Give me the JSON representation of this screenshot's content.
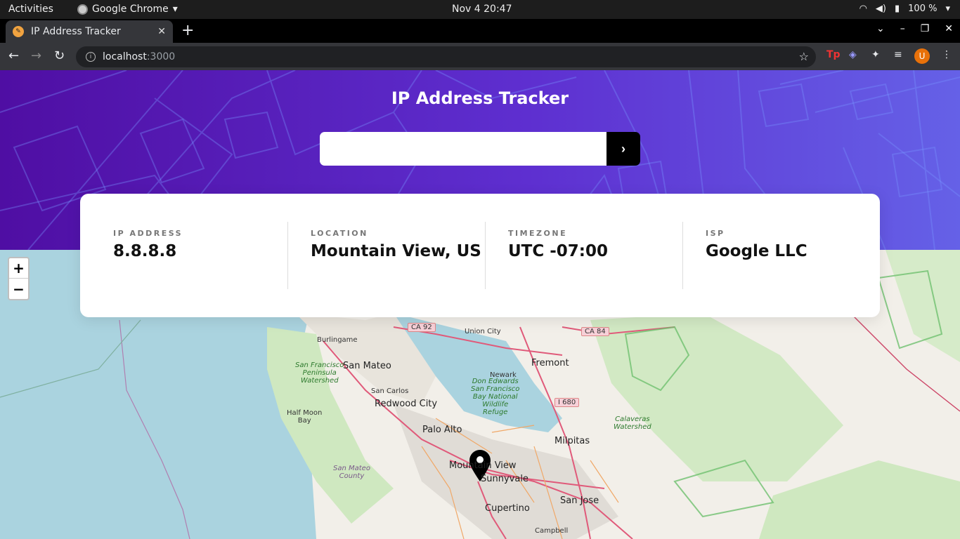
{
  "os": {
    "activities": "Activities",
    "app_name": "Google Chrome",
    "clock": "Nov 4  20:47",
    "battery": "100 %"
  },
  "browser": {
    "tab_title": "IP Address Tracker",
    "url_host": "localhost",
    "url_port": ":3000",
    "profile_initial": "U"
  },
  "page": {
    "heading": "IP Address Tracker",
    "search_value": "",
    "search_button": "›",
    "stats": [
      {
        "label": "IP ADDRESS",
        "value": "8.8.8.8"
      },
      {
        "label": "LOCATION",
        "value": "Mountain View, US"
      },
      {
        "label": "TIMEZONE",
        "value": "UTC -07:00"
      },
      {
        "label": "ISP",
        "value": "Google LLC"
      }
    ]
  },
  "map": {
    "zoom_in": "+",
    "zoom_out": "−",
    "labels": {
      "burlingame": "Burlingame",
      "san_mateo": "San Mateo",
      "san_carlos": "San Carlos",
      "redwood_city": "Redwood City",
      "half_moon_bay": "Half Moon\nBay",
      "palo_alto": "Palo Alto",
      "mountain_view": "Mountain View",
      "sunnyvale": "Sunnyvale",
      "cupertino": "Cupertino",
      "san_jose": "San Jose",
      "campbell": "Campbell",
      "milpitas": "Milpitas",
      "fremont": "Fremont",
      "newark": "Newark",
      "union_city": "Union City",
      "sf_watershed": "San Francisco\nPeninsula\nWatershed",
      "don_edwards": "Don Edwards\nSan Francisco\nBay National\nWildlife\nRefuge",
      "san_mateo_county": "San Mateo\nCounty",
      "calaveras": "Calaveras\nWatershed"
    },
    "shields": {
      "ca92": "CA 92",
      "ca84": "CA 84",
      "i680": "I 680"
    }
  }
}
